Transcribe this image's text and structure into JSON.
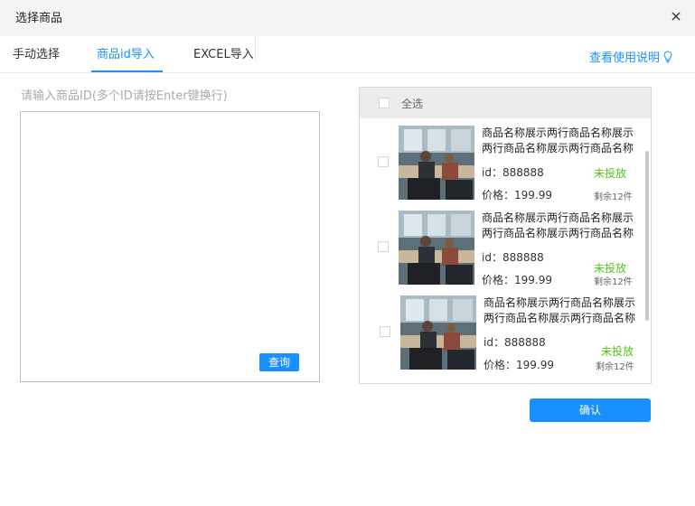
{
  "dialog": {
    "title": "选择商品"
  },
  "tabs": [
    {
      "label": "手动选择",
      "active": false
    },
    {
      "label": "商品id导入",
      "active": true
    },
    {
      "label": "EXCEL导入",
      "active": false
    }
  ],
  "help": {
    "label": "查看使用说明",
    "icon": "lightbulb-icon"
  },
  "import": {
    "hint": "请输入商品ID(多个ID请按Enter键换行)",
    "value": "",
    "query_label": "查询"
  },
  "products": {
    "select_all_label": "全选",
    "items": [
      {
        "name_line1": "商品名称展示两行商品名称展示",
        "name_line2": "两行商品名称展示两行商品名称",
        "id": "id：888888",
        "price": "价格：199.99",
        "status": "未投放",
        "stock": "剩余12件"
      },
      {
        "name_line1": "商品名称展示两行商品名称展示",
        "name_line2": "两行商品名称展示两行商品名称",
        "id": "id：888888",
        "price": "价格：199.99",
        "status": "未投放",
        "stock": "剩余12件"
      },
      {
        "name_line1": "商品名称展示两行商品名称展示",
        "name_line2": "两行商品名称展示两行商品名称",
        "id": "id：888888",
        "price": "价格：199.99",
        "status": "未投放",
        "stock": "剩余12件"
      }
    ]
  },
  "confirm_label": "确认",
  "colors": {
    "accent": "#1890ff",
    "status_green": "#52c41a"
  }
}
